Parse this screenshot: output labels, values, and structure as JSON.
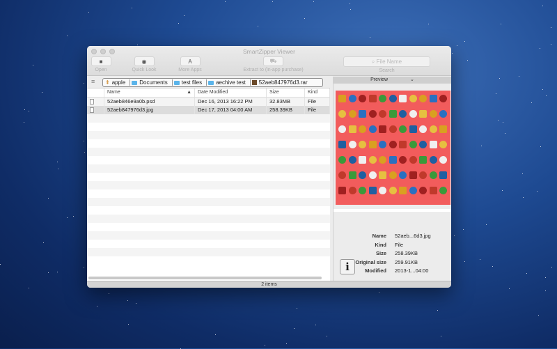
{
  "window": {
    "title": "SmartZipper Viewer"
  },
  "toolbar": {
    "open": "Open",
    "quick_look": "Quick Look",
    "more_apps": "More Apps",
    "extract": "Extract to (in-app purchase)",
    "search_placeholder": "File Name",
    "search_label": "Search"
  },
  "path": [
    "apple",
    "Documents",
    "test files",
    "aechive test",
    "52aeb847976d3.rar"
  ],
  "columns": {
    "name": "Name",
    "date": "Date Modified",
    "size": "Size",
    "kind": "Kind"
  },
  "files": [
    {
      "name": "52aeb846e9a0b.psd",
      "date": "Dec 16, 2013 16:22 PM",
      "size": "32.83MB",
      "kind": "File"
    },
    {
      "name": "52aeb847976d3.jpg",
      "date": "Dec 17, 2013 04:00 AM",
      "size": "258.39KB",
      "kind": "File",
      "selected": true
    }
  ],
  "preview": {
    "label": "Preview",
    "background": "#f25c5c"
  },
  "info": {
    "name_label": "Name",
    "name": "52aeb...6d3.jpg",
    "kind_label": "Kind",
    "kind": "File",
    "size_label": "Size",
    "size": "258.39KB",
    "orig_label": "Original size",
    "orig": "259.91KB",
    "mod_label": "Modified",
    "mod": "2013-1...04:00"
  },
  "status": "2 items"
}
